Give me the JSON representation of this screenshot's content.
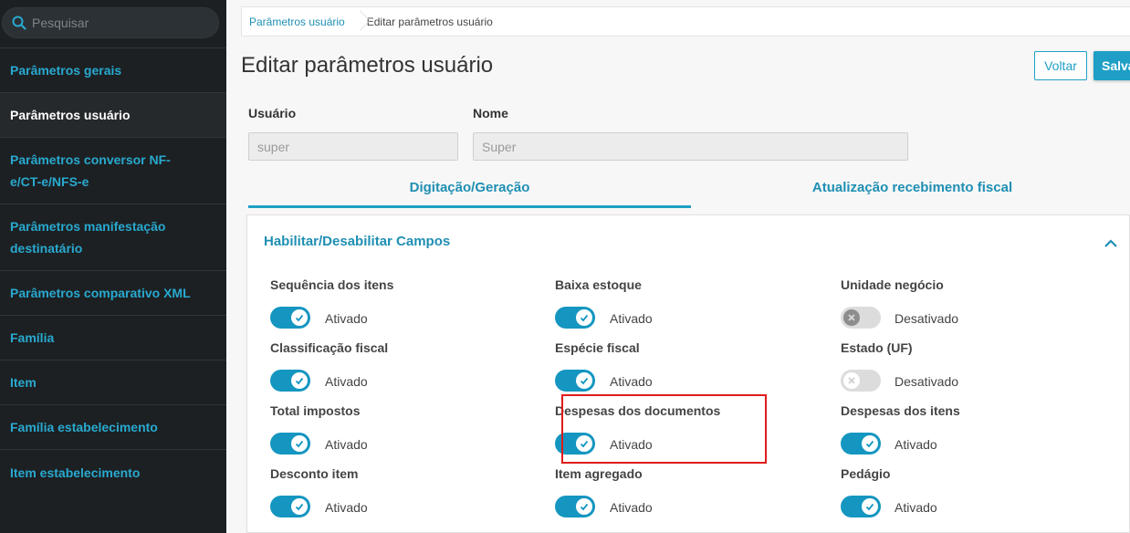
{
  "sidebar": {
    "search_placeholder": "Pesquisar",
    "items": [
      {
        "label": "Parâmetros gerais",
        "active": false
      },
      {
        "label": "Parâmetros usuário",
        "active": true
      },
      {
        "label": "Parâmetros conversor NF-e/CT-e/NFS-e",
        "active": false
      },
      {
        "label": "Parâmetros manifestação destinatário",
        "active": false
      },
      {
        "label": "Parâmetros comparativo XML",
        "active": false
      },
      {
        "label": "Família",
        "active": false
      },
      {
        "label": "Item",
        "active": false
      },
      {
        "label": "Família estabelecimento",
        "active": false
      },
      {
        "label": "Item estabelecimento",
        "active": false
      }
    ]
  },
  "breadcrumb": {
    "link": "Parâmetros usuário",
    "current": "Editar parâmetros usuário"
  },
  "page": {
    "title": "Editar parâmetros usuário"
  },
  "actions": {
    "back_label": "Voltar",
    "save_label": "Salvar"
  },
  "form": {
    "usuario_label": "Usuário",
    "usuario_value": "super",
    "nome_label": "Nome",
    "nome_value": "Super"
  },
  "tabs": [
    {
      "label": "Digitação/Geração",
      "active": true
    },
    {
      "label": "Atualização recebimento fiscal",
      "active": false
    }
  ],
  "panel": {
    "title": "Habilitar/Desabilitar Campos",
    "toggles": [
      {
        "label": "Sequência dos itens",
        "state": "Ativado",
        "on": true
      },
      {
        "label": "Baixa estoque",
        "state": "Ativado",
        "on": true
      },
      {
        "label": "Unidade negócio",
        "state": "Desativado",
        "on": false
      },
      {
        "label": "Classificação fiscal",
        "state": "Ativado",
        "on": true
      },
      {
        "label": "Espécie fiscal",
        "state": "Ativado",
        "on": true
      },
      {
        "label": "Estado (UF)",
        "state": "Desativado",
        "on": false
      },
      {
        "label": "Total impostos",
        "state": "Ativado",
        "on": true
      },
      {
        "label": "Despesas dos documentos",
        "state": "Ativado",
        "on": true
      },
      {
        "label": "Despesas dos itens",
        "state": "Ativado",
        "on": true
      },
      {
        "label": "Desconto item",
        "state": "Ativado",
        "on": true
      },
      {
        "label": "Item agregado",
        "state": "Ativado",
        "on": true
      },
      {
        "label": "Pedágio",
        "state": "Ativado",
        "on": true
      }
    ]
  },
  "colors": {
    "accent": "#1f9fc6",
    "sidebar_bg": "#1c2023",
    "highlight": "#e01b1b"
  }
}
